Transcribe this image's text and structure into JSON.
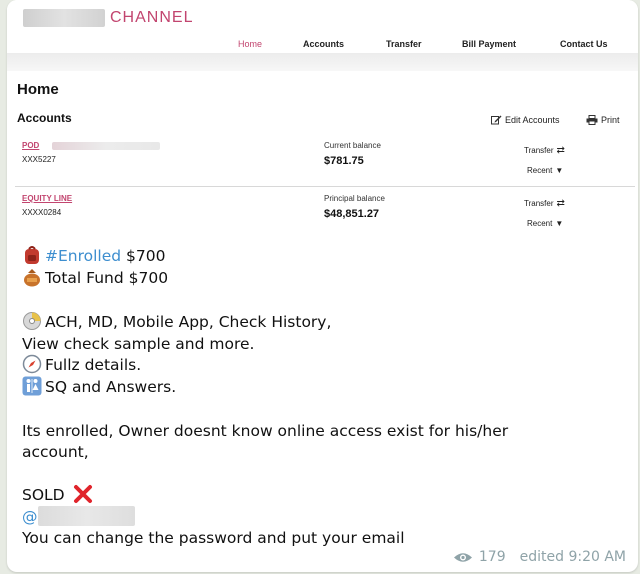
{
  "site": {
    "logo_text": "CHANNEL",
    "nav": [
      {
        "label": "Home"
      },
      {
        "label": "Accounts"
      },
      {
        "label": "Transfer"
      },
      {
        "label": "Bill Payment"
      },
      {
        "label": "Contact Us"
      }
    ],
    "page_title": "Home",
    "section_title": "Accounts",
    "tools": {
      "edit": "Edit Accounts",
      "print": "Print"
    },
    "accounts": [
      {
        "name": "POD",
        "number": "XXX5227",
        "balance_label": "Current balance",
        "balance": "$781.75",
        "action1": "Transfer",
        "action2": "Recent"
      },
      {
        "name": "EQUITY LINE",
        "number": "XXXX0284",
        "balance_label": "Principal balance",
        "balance": "$48,851.27",
        "action1": "Transfer",
        "action2": "Recent"
      }
    ]
  },
  "message": {
    "hashtag": "#Enrolled",
    "enrolled_amount": "$700",
    "total_fund": "Total Fund $700",
    "features_line1": "ACH, MD, Mobile App, Check History,",
    "features_line2": "View check sample and more.",
    "fullz": "Fullz details.",
    "sq": "SQ and  Answers.",
    "note_line1": "Its enrolled, Owner doesnt know online access exist for his/her",
    "note_line2": "account,",
    "sold": "SOLD",
    "mention_prefix": "@",
    "change": "You can change the password and put your email"
  },
  "meta": {
    "views": "179",
    "edited": "edited 9:20 AM"
  },
  "colors": {
    "brand": "#c2456f",
    "link": "#3d8ecf",
    "meta": "#8fa3a8",
    "sold_x": "#e0242b"
  }
}
